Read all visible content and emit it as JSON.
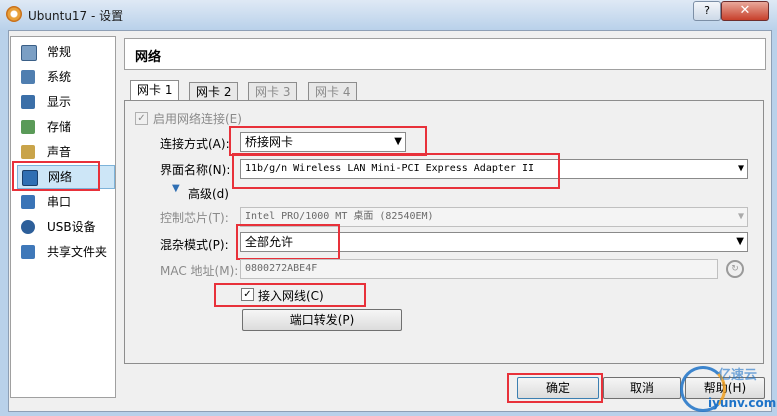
{
  "window": {
    "title": "Ubuntu17 - 设置",
    "help_label": "?",
    "close_label": "✕"
  },
  "sidebar": {
    "items": [
      {
        "label": "常规",
        "icon": "monitor-icon"
      },
      {
        "label": "系统",
        "icon": "chip-icon"
      },
      {
        "label": "显示",
        "icon": "display-icon"
      },
      {
        "label": "存储",
        "icon": "disk-icon"
      },
      {
        "label": "声音",
        "icon": "speaker-icon"
      },
      {
        "label": "网络",
        "icon": "network-icon"
      },
      {
        "label": "串口",
        "icon": "serial-icon"
      },
      {
        "label": "USB设备",
        "icon": "usb-icon"
      },
      {
        "label": "共享文件夹",
        "icon": "folder-icon"
      }
    ],
    "selected": "网络"
  },
  "header": {
    "title": "网络"
  },
  "tabs": [
    {
      "label": "网卡 1",
      "active": true
    },
    {
      "label": "网卡 2",
      "active": false
    },
    {
      "label": "网卡 3",
      "active": false
    },
    {
      "label": "网卡 4",
      "active": false
    }
  ],
  "form": {
    "enable_label": "启用网络连接(E)",
    "attach_label": "连接方式(A):",
    "attach_value": "桥接网卡",
    "name_label": "界面名称(N):",
    "name_value": "11b/g/n  Wireless LAN Mini-PCI Express Adapter II",
    "advanced_label": "高级(d)",
    "adapter_type_label": "控制芯片(T):",
    "adapter_type_value": "Intel PRO/1000 MT 桌面 (82540EM)",
    "promisc_label": "混杂模式(P):",
    "promisc_value": "全部允许",
    "mac_label": "MAC 地址(M):",
    "mac_value": "0800272ABE4F",
    "cable_label": "接入网线(C)",
    "port_forward_label": "端口转发(P)"
  },
  "footer": {
    "ok_label": "确定",
    "cancel_label": "取消",
    "help_label": "帮助(H)"
  },
  "watermark": {
    "line1": "亿速云",
    "line2": "iyunv.com"
  }
}
